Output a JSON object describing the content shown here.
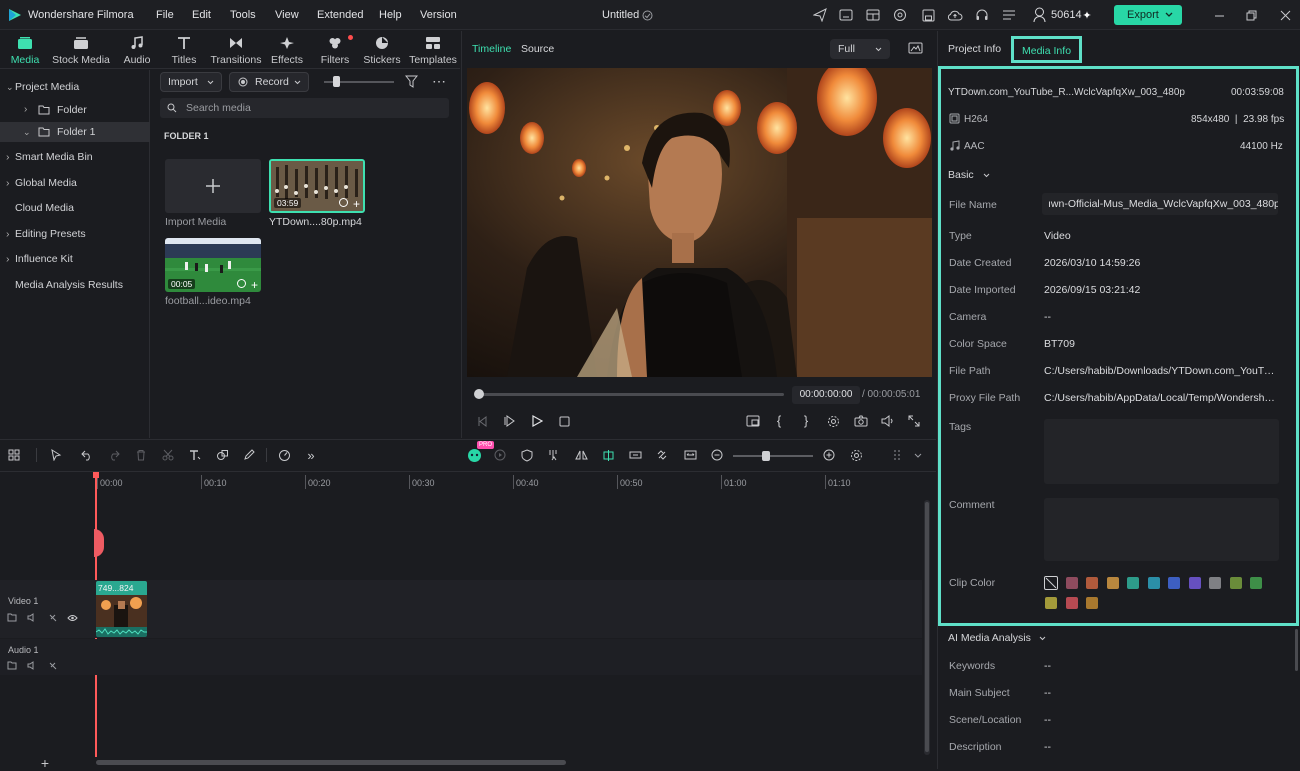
{
  "app": {
    "name": "Wondershare Filmora",
    "menus": [
      "File",
      "Edit",
      "Tools",
      "View",
      "Extended",
      "Help",
      "Version"
    ],
    "project_title": "Untitled",
    "credits": "50614",
    "export_label": "Export"
  },
  "media_tabs": [
    {
      "label": "Media",
      "icon": "media-icon",
      "active": true
    },
    {
      "label": "Stock Media",
      "icon": "stock-media-icon"
    },
    {
      "label": "Audio",
      "icon": "music-note-icon"
    },
    {
      "label": "Titles",
      "icon": "titles-icon"
    },
    {
      "label": "Transitions",
      "icon": "transitions-icon"
    },
    {
      "label": "Effects",
      "icon": "effects-icon"
    },
    {
      "label": "Filters",
      "icon": "filters-icon"
    },
    {
      "label": "Stickers",
      "icon": "stickers-icon"
    },
    {
      "label": "Templates",
      "icon": "templates-icon"
    }
  ],
  "sidebar": {
    "project_media": "Project Media",
    "folder": "Folder",
    "folder1": "Folder 1",
    "items": [
      "Smart Media Bin",
      "Global Media",
      "Cloud Media",
      "Editing Presets",
      "Influence Kit",
      "Media Analysis Results"
    ]
  },
  "media": {
    "import_label": "Import",
    "record_label": "Record",
    "search_placeholder": "Search media",
    "folder_heading": "FOLDER 1",
    "import_media_label": "Import Media",
    "clips": [
      {
        "name": "YTDown....80p.mp4",
        "duration": "03:59"
      },
      {
        "name": "football...ideo.mp4",
        "duration": "00:05"
      }
    ]
  },
  "preview": {
    "tab_timeline": "Timeline",
    "tab_source": "Source",
    "quality": "Full",
    "current_time": "00:00:00:00",
    "total_time": "/ 00:00:05:01"
  },
  "info": {
    "tab_project": "Project Info",
    "tab_media": "Media Info",
    "file_title": "YTDown.com_YouTube_R...WclcVapfqXw_003_480p",
    "duration": "00:03:59:08",
    "video_codec": "H264",
    "resolution": "854x480  |  23.98 fps",
    "audio_codec": "AAC",
    "sample_rate": "44100 Hz",
    "basic_label": "Basic",
    "rows": [
      {
        "label": "File Name",
        "value": "ıwn-Official-Mus_Media_WclcVapfqXw_003_480p"
      },
      {
        "label": "Type",
        "value": "Video"
      },
      {
        "label": "Date Created",
        "value": "2026/03/10 14:59:26"
      },
      {
        "label": "Date Imported",
        "value": "2026/09/15 03:21:42"
      },
      {
        "label": "Camera",
        "value": "--"
      },
      {
        "label": "Color Space",
        "value": "BT709"
      },
      {
        "label": "File Path",
        "value": "C:/Users/habib/Downloads/YTDown.com_YouTub..."
      },
      {
        "label": "Proxy File Path",
        "value": "C:/Users/habib/AppData/Local/Temp/Wondershar..."
      }
    ],
    "tags_label": "Tags",
    "comment_label": "Comment",
    "clip_color_label": "Clip Color",
    "clip_colors": [
      "#8e4b5e",
      "#b05a3c",
      "#b8873e",
      "#2d9c8a",
      "#2b8fa8",
      "#3d5fc2",
      "#6650c0",
      "#7f8084",
      "#6a8c3a",
      "#3e8f48",
      "#a39a3a",
      "#b64a52",
      "#a8782e"
    ],
    "ai_label": "AI Media Analysis",
    "ai_rows": [
      {
        "label": "Keywords",
        "value": "--"
      },
      {
        "label": "Main Subject",
        "value": "--"
      },
      {
        "label": "Scene/Location",
        "value": "--"
      },
      {
        "label": "Description",
        "value": "--"
      }
    ]
  },
  "timeline": {
    "ruler": [
      "00:00",
      "00:10",
      "00:20",
      "00:30",
      "00:40",
      "00:50",
      "01:00",
      "01:10"
    ],
    "video_track": "Video 1",
    "audio_track": "Audio 1",
    "clip_label": "749...824",
    "pro_badge": "PRO"
  },
  "colors": {
    "accent": "#3ee0b0",
    "export": "#28d7a6",
    "highlight": "#5fe0c8"
  }
}
